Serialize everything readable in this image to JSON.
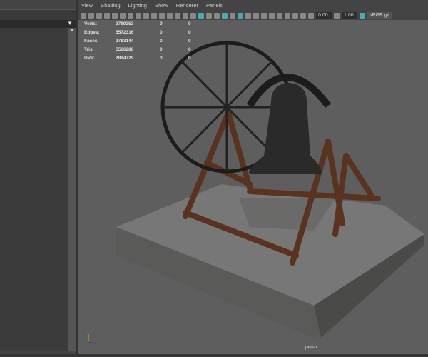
{
  "menu": [
    "View",
    "Shading",
    "Lighting",
    "Show",
    "Renderer",
    "Panels"
  ],
  "toolbar": {
    "exposure": "0.00",
    "gamma": "1.00",
    "color_space": "sRGB ga"
  },
  "stats": [
    {
      "label": "Verts:",
      "total": "2789353",
      "selected": "0",
      "other": "0"
    },
    {
      "label": "Edges:",
      "total": "5572316",
      "selected": "0",
      "other": "0"
    },
    {
      "label": "Faces:",
      "total": "2783144",
      "selected": "0",
      "other": "0"
    },
    {
      "label": "Tris:",
      "total": "5566288",
      "selected": "0",
      "other": "0"
    },
    {
      "label": "UVs:",
      "total": "2884729",
      "selected": "0",
      "other": "0"
    }
  ],
  "camera": "persp",
  "axis": {
    "y": "Y",
    "x": "X",
    "z": "Z"
  },
  "colors": {
    "viewport_bg": "#5e5e5e",
    "accent": "#4aa8b8"
  }
}
